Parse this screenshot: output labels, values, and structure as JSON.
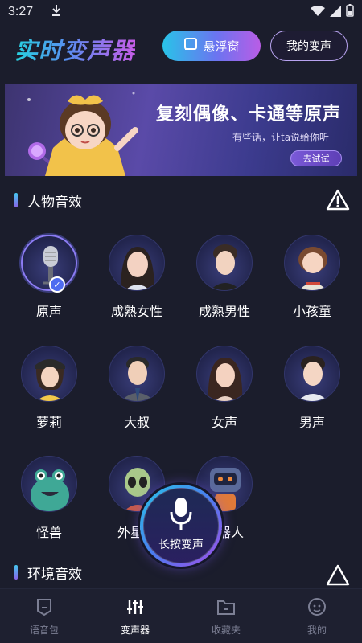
{
  "status": {
    "time": "3:27",
    "download_icon": "download-icon",
    "wifi_icon": "wifi-icon",
    "signal_icon": "signal-icon",
    "battery_icon": "battery-icon"
  },
  "header": {
    "logo": "实时变声器",
    "float_button": "悬浮窗",
    "my_voice_button": "我的变声"
  },
  "banner": {
    "title": "复刻偶像、卡通等原声",
    "subtitle": "有些话，让ta说给你听",
    "cta": "去试试"
  },
  "sections": {
    "characters": "人物音效",
    "environment": "环境音效"
  },
  "voices": [
    {
      "label": "原声",
      "icon": "microphone-avatar",
      "selected": true
    },
    {
      "label": "成熟女性",
      "icon": "woman-avatar",
      "selected": false
    },
    {
      "label": "成熟男性",
      "icon": "man-avatar",
      "selected": false
    },
    {
      "label": "小孩童",
      "icon": "child-avatar",
      "selected": false
    },
    {
      "label": "萝莉",
      "icon": "girl-avatar",
      "selected": false
    },
    {
      "label": "大叔",
      "icon": "uncle-avatar",
      "selected": false
    },
    {
      "label": "女声",
      "icon": "female-avatar",
      "selected": false
    },
    {
      "label": "男声",
      "icon": "male-avatar",
      "selected": false
    },
    {
      "label": "怪兽",
      "icon": "monster-avatar",
      "selected": false
    },
    {
      "label": "外星人",
      "icon": "alien-avatar",
      "selected": false
    },
    {
      "label": "机器人",
      "icon": "robot-avatar",
      "selected": false
    }
  ],
  "hold_button": "长按变声",
  "tabs": [
    {
      "label": "语音包",
      "icon": "voice-pack-icon",
      "active": false
    },
    {
      "label": "变声器",
      "icon": "equalizer-icon",
      "active": true
    },
    {
      "label": "收藏夹",
      "icon": "folder-icon",
      "active": false
    },
    {
      "label": "我的",
      "icon": "profile-icon",
      "active": false
    }
  ],
  "colors": {
    "background": "#1b1d2c",
    "accent_cyan": "#29c3e8",
    "accent_purple": "#b95de6",
    "check": "#4f6cf0"
  }
}
